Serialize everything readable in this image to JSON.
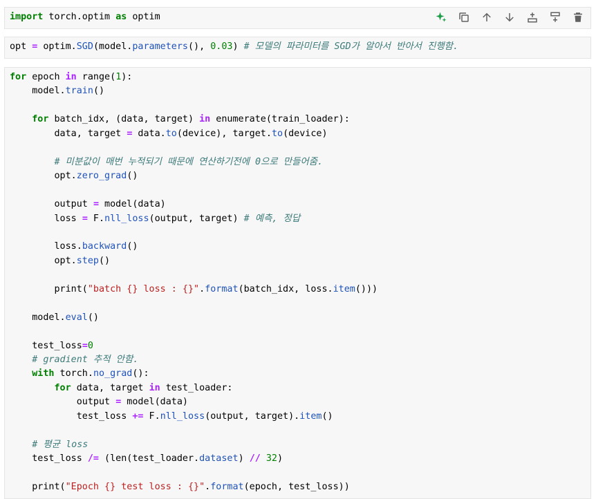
{
  "cells": [
    {
      "id": "cell-1",
      "toolbar": [
        "generate-ai-icon",
        "duplicate-cell-icon",
        "move-up-icon",
        "move-down-icon",
        "insert-above-icon",
        "insert-below-icon",
        "delete-icon"
      ],
      "lines": [
        [
          [
            "kw",
            "import"
          ],
          [
            "t",
            " torch.optim "
          ],
          [
            "kw",
            "as"
          ],
          [
            "t",
            " optim"
          ]
        ]
      ]
    },
    {
      "id": "cell-2",
      "lines": [
        [
          [
            "t",
            "opt "
          ],
          [
            "op",
            "="
          ],
          [
            "t",
            " optim."
          ],
          [
            "attr",
            "SGD"
          ],
          [
            "t",
            "(model."
          ],
          [
            "attr",
            "parameters"
          ],
          [
            "t",
            "(), "
          ],
          [
            "num",
            "0.03"
          ],
          [
            "t",
            ") "
          ],
          [
            "cmt",
            "# 모델의 파라미터를 SGD가 알아서 반아서 진행함."
          ]
        ]
      ]
    },
    {
      "id": "cell-3",
      "lines": [
        [
          [
            "kw",
            "for"
          ],
          [
            "t",
            " epoch "
          ],
          [
            "op",
            "in"
          ],
          [
            "t",
            " range("
          ],
          [
            "num",
            "1"
          ],
          [
            "t",
            "):"
          ]
        ],
        [
          [
            "t",
            "    model."
          ],
          [
            "attr",
            "train"
          ],
          [
            "t",
            "()"
          ]
        ],
        [],
        [
          [
            "t",
            "    "
          ],
          [
            "kw",
            "for"
          ],
          [
            "t",
            " batch_idx, (data, target) "
          ],
          [
            "op",
            "in"
          ],
          [
            "t",
            " enumerate(train_loader):"
          ]
        ],
        [
          [
            "t",
            "        data, target "
          ],
          [
            "op",
            "="
          ],
          [
            "t",
            " data."
          ],
          [
            "attr",
            "to"
          ],
          [
            "t",
            "(device), target."
          ],
          [
            "attr",
            "to"
          ],
          [
            "t",
            "(device)"
          ]
        ],
        [],
        [
          [
            "t",
            "        "
          ],
          [
            "cmt",
            "# 미분값이 매번 누적되기 때문에 연산하기전에 0으로 만들어줌."
          ]
        ],
        [
          [
            "t",
            "        opt."
          ],
          [
            "attr",
            "zero_grad"
          ],
          [
            "t",
            "()"
          ]
        ],
        [],
        [
          [
            "t",
            "        output "
          ],
          [
            "op",
            "="
          ],
          [
            "t",
            " model(data)"
          ]
        ],
        [
          [
            "t",
            "        loss "
          ],
          [
            "op",
            "="
          ],
          [
            "t",
            " F."
          ],
          [
            "attr",
            "nll_loss"
          ],
          [
            "t",
            "(output, target) "
          ],
          [
            "cmt",
            "# 예측, 정답"
          ]
        ],
        [],
        [
          [
            "t",
            "        loss."
          ],
          [
            "attr",
            "backward"
          ],
          [
            "t",
            "()"
          ]
        ],
        [
          [
            "t",
            "        opt."
          ],
          [
            "attr",
            "step"
          ],
          [
            "t",
            "()"
          ]
        ],
        [],
        [
          [
            "t",
            "        print("
          ],
          [
            "str",
            "\"batch {} loss : {}\""
          ],
          [
            "t",
            "."
          ],
          [
            "attr",
            "format"
          ],
          [
            "t",
            "(batch_idx, loss."
          ],
          [
            "attr",
            "item"
          ],
          [
            "t",
            "()))"
          ]
        ],
        [],
        [
          [
            "t",
            "    model."
          ],
          [
            "attr",
            "eval"
          ],
          [
            "t",
            "()"
          ]
        ],
        [],
        [
          [
            "t",
            "    test_loss"
          ],
          [
            "op",
            "="
          ],
          [
            "num",
            "0"
          ]
        ],
        [
          [
            "t",
            "    "
          ],
          [
            "cmt",
            "# gradient 추적 안함."
          ]
        ],
        [
          [
            "t",
            "    "
          ],
          [
            "kw",
            "with"
          ],
          [
            "t",
            " torch."
          ],
          [
            "attr",
            "no_grad"
          ],
          [
            "t",
            "():"
          ]
        ],
        [
          [
            "t",
            "        "
          ],
          [
            "kw",
            "for"
          ],
          [
            "t",
            " data, target "
          ],
          [
            "op",
            "in"
          ],
          [
            "t",
            " test_loader:"
          ]
        ],
        [
          [
            "t",
            "            output "
          ],
          [
            "op",
            "="
          ],
          [
            "t",
            " model(data)"
          ]
        ],
        [
          [
            "t",
            "            test_loss "
          ],
          [
            "op",
            "+="
          ],
          [
            "t",
            " F."
          ],
          [
            "attr",
            "nll_loss"
          ],
          [
            "t",
            "(output, target)."
          ],
          [
            "attr",
            "item"
          ],
          [
            "t",
            "()"
          ]
        ],
        [],
        [
          [
            "t",
            "    "
          ],
          [
            "cmt",
            "# 평균 loss"
          ]
        ],
        [
          [
            "t",
            "    test_loss "
          ],
          [
            "op",
            "/="
          ],
          [
            "t",
            " (len(test_loader."
          ],
          [
            "attr",
            "dataset"
          ],
          [
            "t",
            ") "
          ],
          [
            "op",
            "//"
          ],
          [
            "t",
            " "
          ],
          [
            "num",
            "32"
          ],
          [
            "t",
            ")"
          ]
        ],
        [],
        [
          [
            "t",
            "    print("
          ],
          [
            "str",
            "\"Epoch {} test loss : {}\""
          ],
          [
            "t",
            "."
          ],
          [
            "attr",
            "format"
          ],
          [
            "t",
            "(epoch, test_loss))"
          ]
        ]
      ]
    }
  ]
}
